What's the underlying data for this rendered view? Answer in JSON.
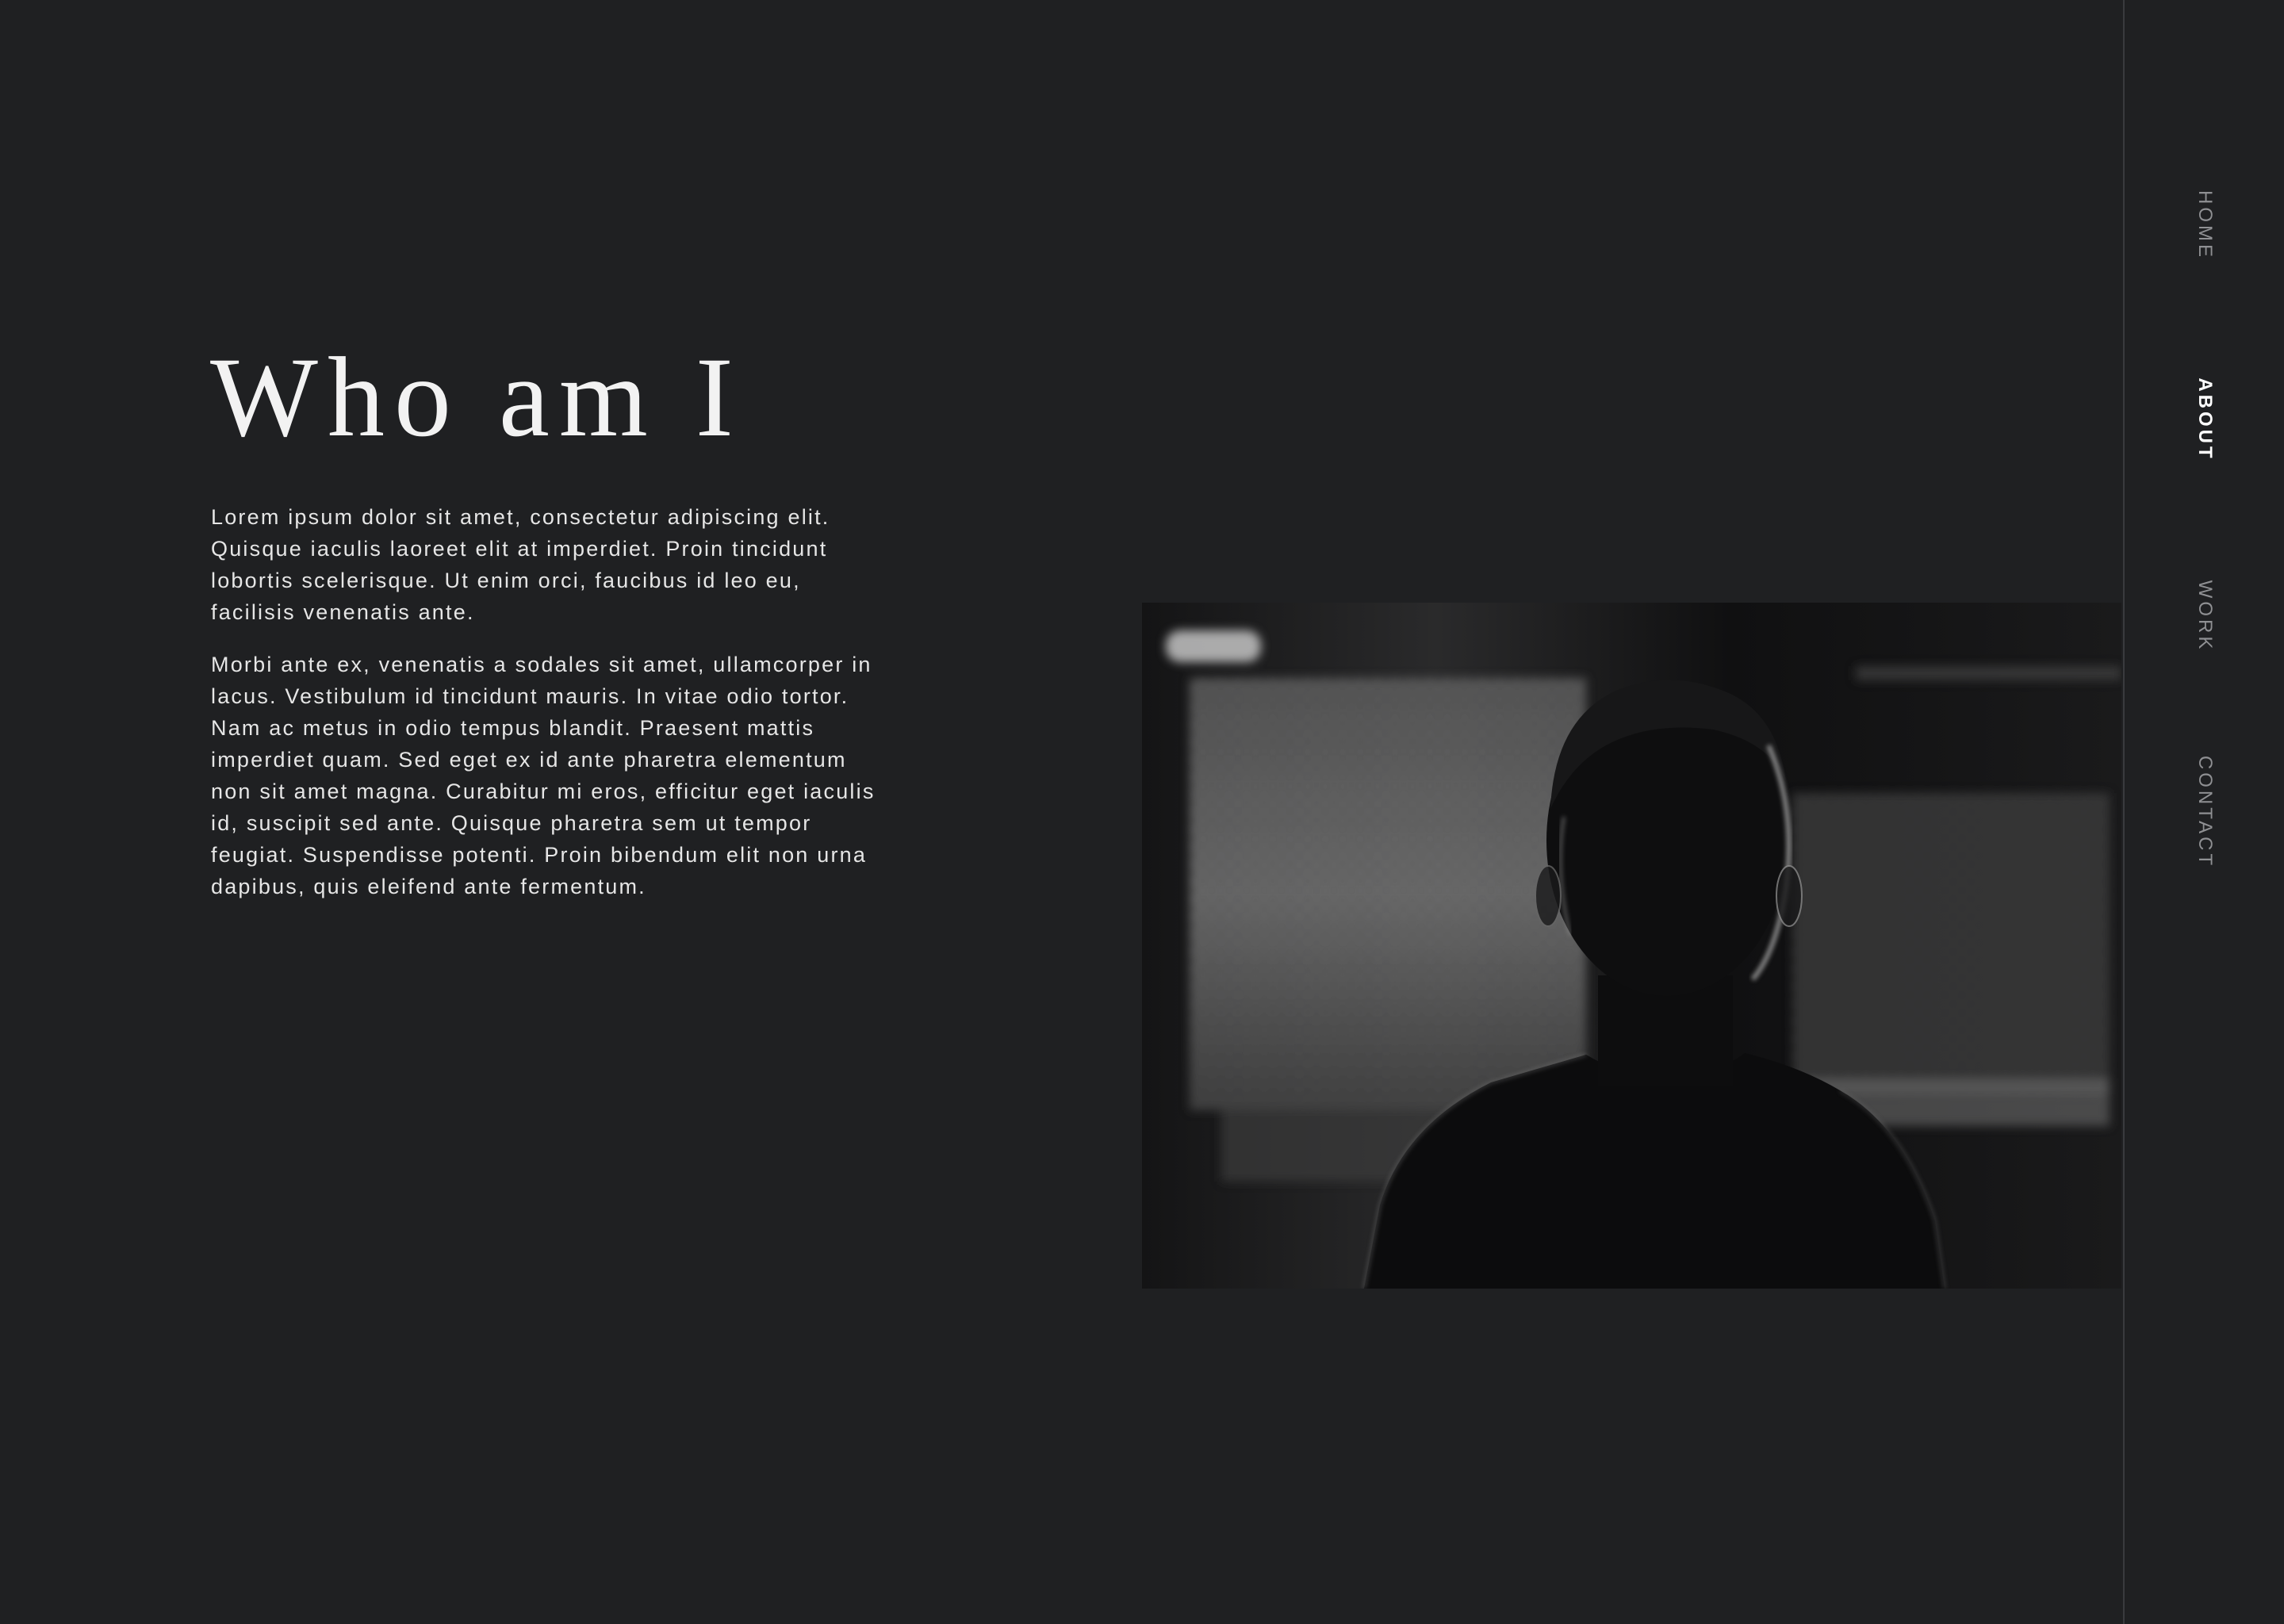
{
  "main": {
    "title": "Who am I",
    "paragraphs": [
      "Lorem ipsum dolor sit amet, consectetur adipiscing elit. Quisque iaculis laoreet elit at imperdiet. Proin tincidunt lobortis scelerisque. Ut enim orci, faucibus id leo eu, facilisis venenatis ante.",
      "Morbi ante ex, venenatis a sodales sit amet, ullamcorper in lacus. Vestibulum id tincidunt mauris. In vitae odio tortor. Nam ac metus in odio tempus blandit. Praesent mattis imperdiet quam. Sed eget ex id ante pharetra elementum non sit amet magna. Curabitur mi eros, efficitur eget iaculis id, suscipit sed ante. Quisque pharetra sem ut tempor feugiat. Suspendisse potenti. Proin bibendum elit non urna dapibus, quis eleifend ante fermentum."
    ]
  },
  "nav": {
    "items": [
      {
        "label": "HOME",
        "active": false
      },
      {
        "label": "ABOUT",
        "active": true
      },
      {
        "label": "WORK",
        "active": false
      },
      {
        "label": "CONTACT",
        "active": false
      }
    ]
  },
  "colors": {
    "background": "#1f2022",
    "text": "#e6e6e6",
    "nav_inactive": "#8f9093",
    "nav_active": "#ffffff",
    "divider": "#3a3b3e"
  }
}
